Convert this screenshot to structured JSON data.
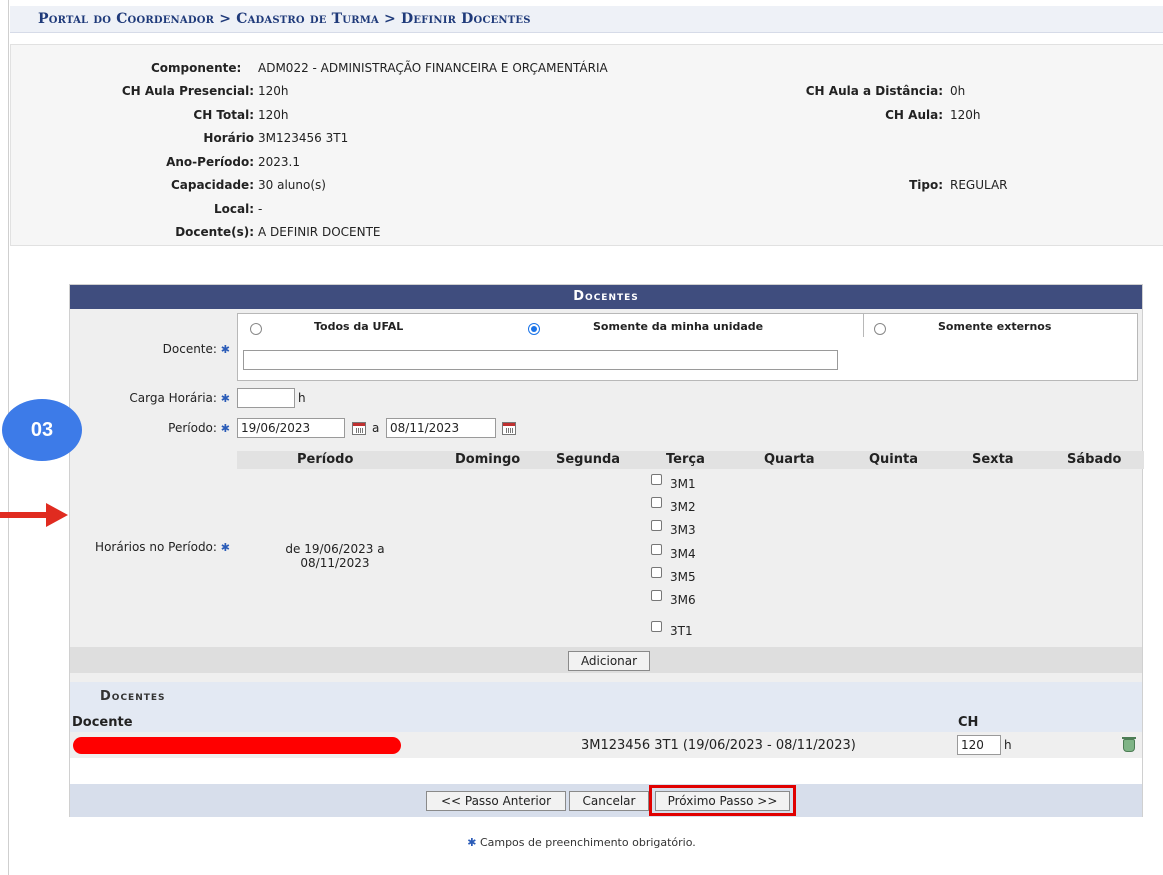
{
  "breadcrumb": "Portal do Coordenador > Cadastro de Turma > Definir Docentes",
  "info": {
    "componente_label": "Componente:",
    "componente": "ADM022 - ADMINISTRAÇÃO FINANCEIRA E ORÇAMENTÁRIA",
    "ch_presencial_label": "CH Aula Presencial:",
    "ch_presencial": "120h",
    "ch_distancia_label": "CH Aula a Distância:",
    "ch_distancia": "0h",
    "ch_total_label": "CH Total:",
    "ch_total": "120h",
    "ch_aula_label": "CH Aula:",
    "ch_aula": "120h",
    "horario_label": "Horário",
    "horario": "3M123456 3T1",
    "ano_periodo_label": "Ano-Período:",
    "ano_periodo": "2023.1",
    "capacidade_label": "Capacidade:",
    "capacidade": "30 aluno(s)",
    "tipo_label": "Tipo:",
    "tipo": "REGULAR",
    "local_label": "Local:",
    "local": "-",
    "docentes_label": "Docente(s):",
    "docentes": "A DEFINIR DOCENTE"
  },
  "panel": {
    "title": "Docentes",
    "docente_label": "Docente:",
    "radio_options": [
      "Todos da UFAL",
      "Somente da minha unidade",
      "Somente externos"
    ],
    "selected_option": "Somente da minha unidade",
    "docente_value": "",
    "carga_label": "Carga Horária:",
    "carga_value": "",
    "carga_unit": "h",
    "periodo_label": "Período:",
    "periodo_start": "19/06/2023",
    "periodo_sep": "a",
    "periodo_end": "08/11/2023",
    "schedule_headers": [
      "Período",
      "Domingo",
      "Segunda",
      "Terça",
      "Quarta",
      "Quinta",
      "Sexta",
      "Sábado"
    ],
    "horarios_label": "Horários no Período:",
    "periodo_range_line1": "de 19/06/2023 a",
    "periodo_range_line2": "08/11/2023",
    "slots": [
      "3M1",
      "3M2",
      "3M3",
      "3M4",
      "3M5",
      "3M6",
      "3T1"
    ],
    "add_button": "Adicionar"
  },
  "list": {
    "title": "Docentes",
    "col_docente": "Docente",
    "col_ch": "CH",
    "rows": [
      {
        "schedule": "3M123456 3T1 (19/06/2023 - 08/11/2023)",
        "ch": "120",
        "unit": "h"
      }
    ]
  },
  "buttons": {
    "prev": "<< Passo Anterior",
    "cancel": "Cancelar",
    "next": "Próximo Passo >>"
  },
  "footnote": "Campos de preenchimento obrigatório.",
  "annotation": {
    "badge": "03"
  },
  "colors": {
    "panel_header": "#3f4d7e",
    "highlight": "#e00000",
    "badge": "#3d7be8",
    "link": "#1f3a7a"
  }
}
